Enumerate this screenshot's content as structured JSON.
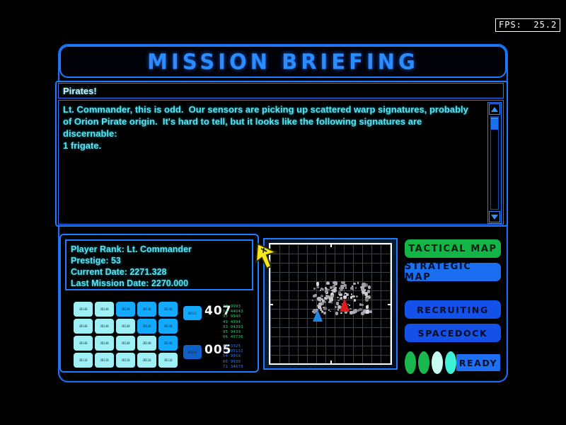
{
  "hud": {
    "fps_label": "FPS:  25.2"
  },
  "header": {
    "title": "MISSION BRIEFING"
  },
  "briefing": {
    "subject": "Pirates!",
    "body": "Lt. Commander, this is odd.  Our sensors are picking up scattered warp signatures, probably\nof Orion Pirate origin.  It's hard to tell, but it looks like the following signatures are\ndiscernable:\n1 frigate.",
    "scroll_up_icon": "triangle-up",
    "scroll_down_icon": "triangle-down"
  },
  "player_info": {
    "lines": [
      "Player Rank: Lt. Commander",
      "Prestige: 53",
      "Current Date: 2271.328",
      "Last Mission Date: 2270.000"
    ]
  },
  "status_panel": {
    "cells": [
      {
        "label": "3D140",
        "state": "pale"
      },
      {
        "label": "3D140",
        "state": "pale"
      },
      {
        "label": "3D140",
        "state": "bright"
      },
      {
        "label": "3D140",
        "state": "bright"
      },
      {
        "label": "3D140",
        "state": "bright"
      },
      {
        "label": "3D140",
        "state": "pale"
      },
      {
        "label": "3D140",
        "state": "pale"
      },
      {
        "label": "3D140",
        "state": "pale"
      },
      {
        "label": "3D140",
        "state": "bright"
      },
      {
        "label": "3D140",
        "state": "bright"
      },
      {
        "label": "3D140",
        "state": "pale"
      },
      {
        "label": "3D140",
        "state": "pale"
      },
      {
        "label": "3D140",
        "state": "pale"
      },
      {
        "label": "3D140",
        "state": "pale"
      },
      {
        "label": "3D140",
        "state": "bright"
      },
      {
        "label": "3D110",
        "state": "pale"
      },
      {
        "label": "3D110",
        "state": "pale"
      },
      {
        "label": "3D110",
        "state": "pale"
      },
      {
        "label": "3D110",
        "state": "pale"
      },
      {
        "label": "3D110",
        "state": "pale"
      }
    ],
    "chip_a": "0D132",
    "chip_b": "8DD48",
    "big_number_a": "407",
    "big_number_b": "005",
    "readout_a": "34 9993\n54 44643\n95 9940\n49 4994\n93 94393\n95 9439\n06 49736",
    "readout_b": "09 3325\n67 95132\n54 9950\n06 9930\n71 34679"
  },
  "tactical_map": {
    "player_marker": "blue-ship-arrow",
    "enemy_marker": "red-ship-arrow",
    "field": "asteroid-field"
  },
  "actions": {
    "tactical_map": "TACTICAL MAP",
    "strategic_map": "STRATEGIC MAP",
    "recruiting": "RECRUITING",
    "spacedock": "SPACEDOCK",
    "ready": "READY"
  },
  "indicators": {
    "ovals": [
      "#19b84f",
      "#19b84f",
      "#c8fbf0",
      "#3ff0d8"
    ]
  },
  "colors": {
    "accent_blue": "#1f7bff",
    "text_cyan": "#57e4f0",
    "green_button": "#13b546",
    "blue_button": "#1a6ef0"
  }
}
